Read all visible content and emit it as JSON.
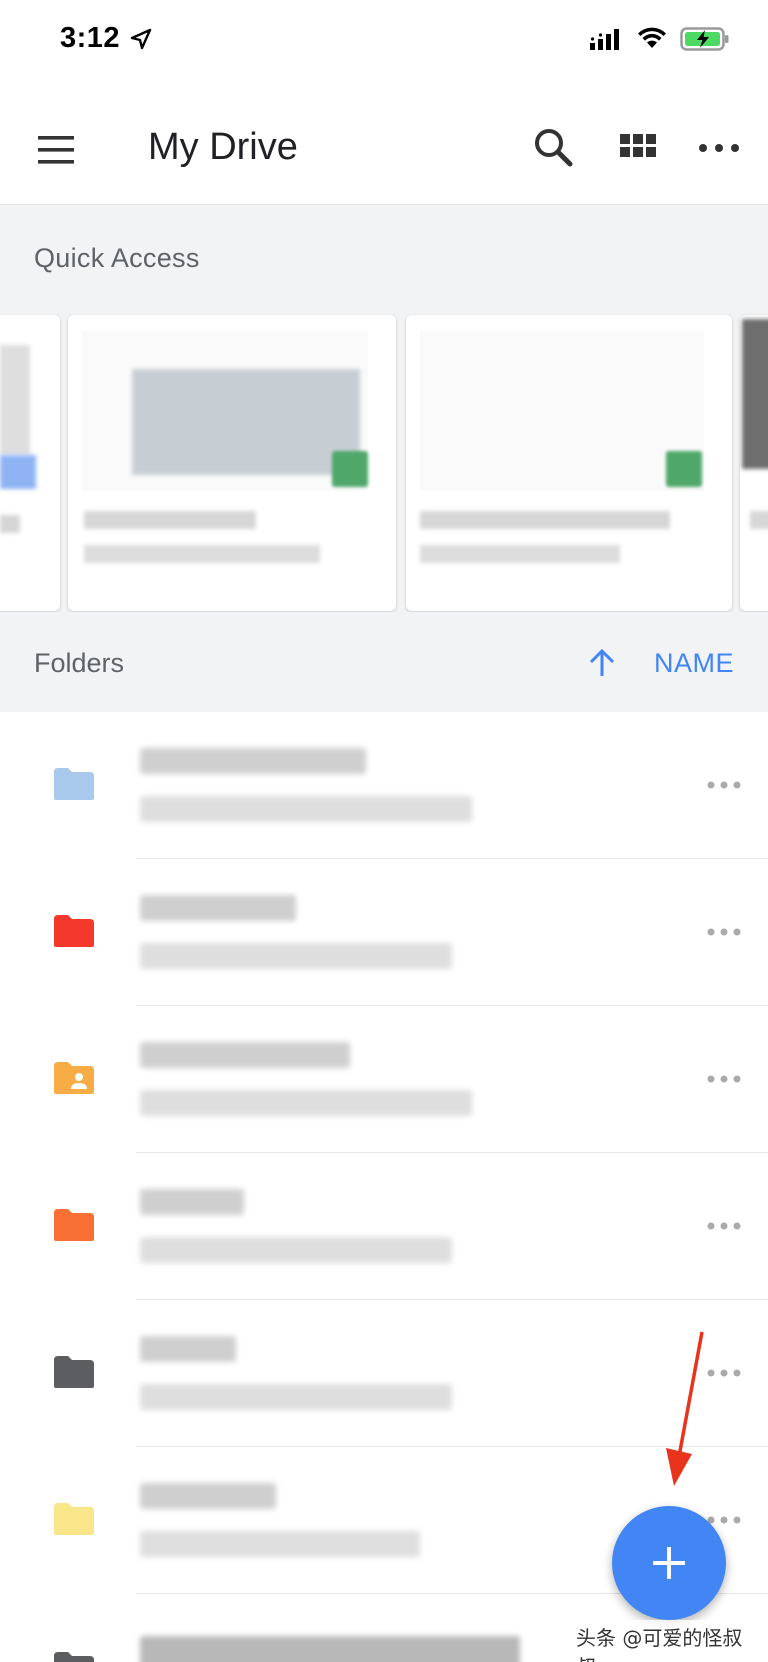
{
  "status_bar": {
    "time": "3:12"
  },
  "app_bar": {
    "title": "My Drive",
    "icons": [
      "menu-icon",
      "search-icon",
      "grid-view-icon",
      "more-icon"
    ]
  },
  "quick_access": {
    "title": "Quick Access"
  },
  "folders": {
    "title": "Folders",
    "sort_label": "NAME",
    "items": [
      {
        "icon": "folder-icon",
        "color": "#a9c9ec",
        "shared": false
      },
      {
        "icon": "folder-icon",
        "color": "#f4382c",
        "shared": false
      },
      {
        "icon": "shared-folder-icon",
        "color": "#f8ac45",
        "shared": true
      },
      {
        "icon": "folder-icon",
        "color": "#f86f33",
        "shared": false
      },
      {
        "icon": "folder-icon",
        "color": "#5b5d60",
        "shared": false
      },
      {
        "icon": "folder-icon",
        "color": "#f9e68a",
        "shared": false
      },
      {
        "icon": "folder-icon",
        "color": "#5b5d60",
        "shared": false
      }
    ]
  },
  "fab": {
    "icon": "plus-icon",
    "color": "#4285f4"
  },
  "annotation": {
    "arrow_color": "#e8341c"
  },
  "watermark": "头条 @可爱的怪叔叔"
}
